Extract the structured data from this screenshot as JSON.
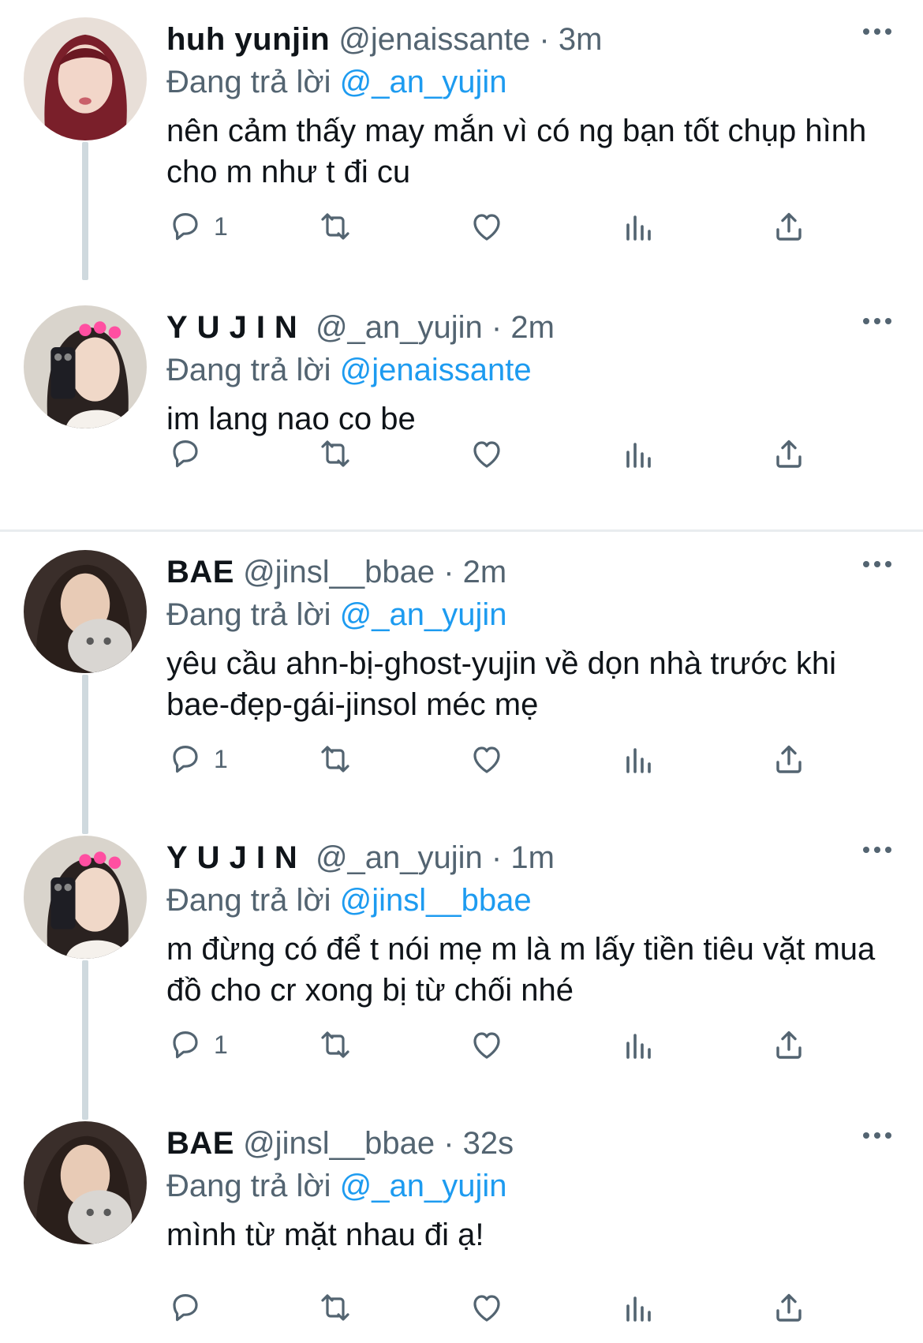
{
  "labels": {
    "replying_to": "Đang trả lời",
    "separator": "·"
  },
  "colors": {
    "accent": "#1d9bf0",
    "secondary_text": "#536471",
    "thread_line": "#cfd9de"
  },
  "icons": {
    "reply": "reply-icon",
    "retweet": "retweet-icon",
    "like": "heart-icon",
    "views": "analytics-icon",
    "share": "share-icon",
    "more": "more-icon"
  },
  "tweets": [
    {
      "name": "huh yunjin",
      "handle": "@jenaissante",
      "time": "3m",
      "reply_to": "@_an_yujin",
      "text": "nên cảm thấy may mắn vì có ng bạn tốt chụp hình cho m như t đi cu",
      "reply_count": "1"
    },
    {
      "name": "YUJIN",
      "handle": "@_an_yujin",
      "time": "2m",
      "reply_to": "@jenaissante",
      "text": "im lang nao co be",
      "reply_count": ""
    },
    {
      "name": "BAE",
      "handle": "@jinsl__bbae",
      "time": "2m",
      "reply_to": "@_an_yujin",
      "text": "yêu cầu ahn-bị-ghost-yujin về dọn nhà trước khi bae-đẹp-gái-jinsol méc mẹ",
      "reply_count": "1"
    },
    {
      "name": "YUJIN",
      "handle": "@_an_yujin",
      "time": "1m",
      "reply_to": "@jinsl__bbae",
      "text": "m đừng có để t nói mẹ m là m lấy tiền tiêu vặt mua đồ cho cr xong bị từ chối nhé",
      "reply_count": "1"
    },
    {
      "name": "BAE",
      "handle": "@jinsl__bbae",
      "time": "32s",
      "reply_to": "@_an_yujin",
      "text": "mình từ mặt nhau đi ạ!",
      "reply_count": ""
    }
  ]
}
